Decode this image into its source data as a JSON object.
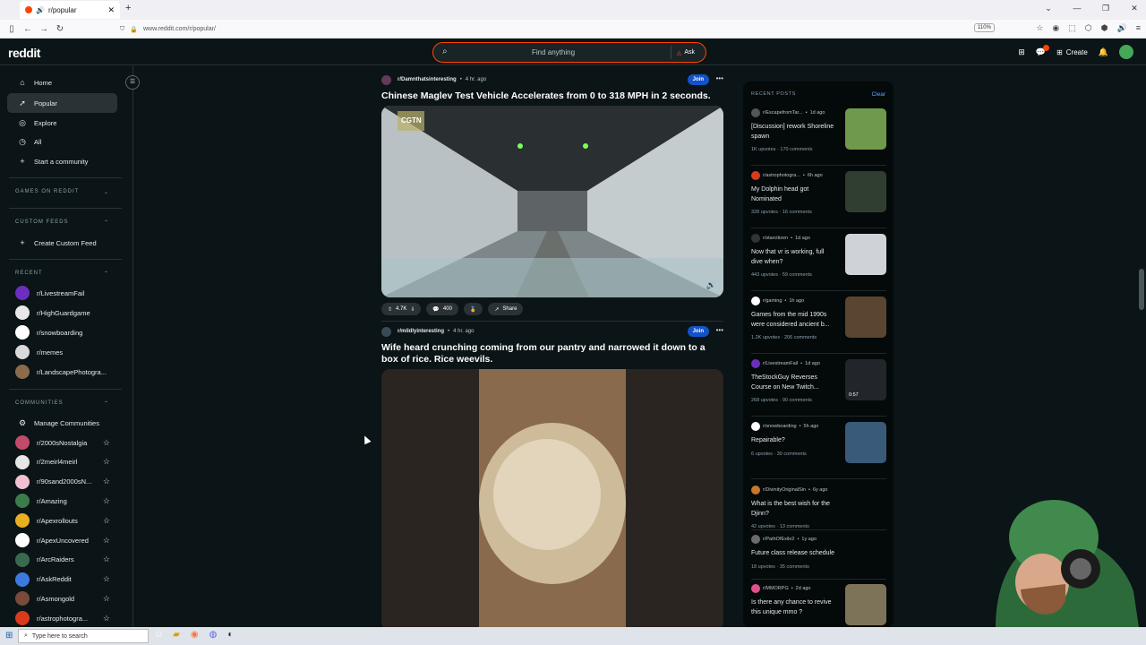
{
  "browser": {
    "tab_title": "r/popular",
    "url": "www.reddit.com/r/popular/",
    "zoom": "110%"
  },
  "header": {
    "logo": "reddit",
    "search_placeholder": "Find anything",
    "ask_label": "Ask",
    "create_label": "Create"
  },
  "sidebar": {
    "nav": [
      {
        "label": "Home",
        "icon": "home-icon"
      },
      {
        "label": "Popular",
        "icon": "popular-icon"
      },
      {
        "label": "Explore",
        "icon": "explore-icon"
      },
      {
        "label": "All",
        "icon": "all-icon"
      },
      {
        "label": "Start a community",
        "icon": "plus-icon"
      }
    ],
    "games_heading": "GAMES ON REDDIT",
    "custom_feeds_heading": "CUSTOM FEEDS",
    "create_custom_feed": "Create Custom Feed",
    "recent_heading": "RECENT",
    "recent": [
      {
        "label": "r/LivestreamFail",
        "color": "#6b2fbf"
      },
      {
        "label": "r/HighGuardgame",
        "color": "#e8e8e8"
      },
      {
        "label": "r/snowboarding",
        "color": "#ffffff"
      },
      {
        "label": "r/memes",
        "color": "#d9d9d9"
      },
      {
        "label": "r/LandscapePhotogra...",
        "color": "#8a6b4a"
      }
    ],
    "communities_heading": "COMMUNITIES",
    "manage_communities": "Manage Communities",
    "communities": [
      {
        "label": "r/2000sNostalgia",
        "color": "#c24a6a"
      },
      {
        "label": "r/2meirl4meirl",
        "color": "#e6e6e6"
      },
      {
        "label": "r/90sand2000sN...",
        "color": "#f2c1d1"
      },
      {
        "label": "r/Amazing",
        "color": "#3e7b4a"
      },
      {
        "label": "r/Apexrollouts",
        "color": "#e8b020"
      },
      {
        "label": "r/ApexUncovered",
        "color": "#ffffff"
      },
      {
        "label": "r/ArcRaiders",
        "color": "#3a6a4e"
      },
      {
        "label": "r/AskReddit",
        "color": "#3d7ae0"
      },
      {
        "label": "r/Asmongold",
        "color": "#7a4a3a"
      },
      {
        "label": "r/astrophotogra...",
        "color": "#d83a1c"
      }
    ]
  },
  "feed": {
    "posts": [
      {
        "subreddit": "r/Damnthatsinteresting",
        "time": "4 hr. ago",
        "join": "Join",
        "title": "Chinese Maglev Test Vehicle Accelerates from 0 to 318 MPH in 2 seconds.",
        "video_watermark": "CGTN",
        "upvotes": "4.7K",
        "comments": "400",
        "share": "Share"
      },
      {
        "subreddit": "r/mildlyinteresting",
        "time": "4 hr. ago",
        "join": "Join",
        "title": "Wife heard crunching coming from our pantry and narrowed it down to a box of rice. Rice weevils."
      }
    ]
  },
  "recent_posts": {
    "heading": "RECENT POSTS",
    "clear": "Clear",
    "items": [
      {
        "sub": "r/EscapefromTar...",
        "time": "1d ago",
        "title": "[Discussion] rework Shoreline spawn",
        "upvotes": "1K upvotes",
        "comments": "170 comments",
        "icon_color": "#555555",
        "thumb_color": "#6f9a4d"
      },
      {
        "sub": "r/astrophotogra...",
        "time": "6h ago",
        "title": "My Dolphin head got Nominated",
        "upvotes": "328 upvotes",
        "comments": "16 comments",
        "icon_color": "#d83a1c",
        "thumb_color": "#2f3e30"
      },
      {
        "sub": "r/starcitizen",
        "time": "1d ago",
        "title": "Now that vr is working, full dive when?",
        "upvotes": "443 upvotes",
        "comments": "59 comments",
        "icon_color": "#333333",
        "thumb_color": "#cfd3d8"
      },
      {
        "sub": "r/gaming",
        "time": "1h ago",
        "title": "Games from the mid 1990s were considered ancient b...",
        "upvotes": "1.2K upvotes",
        "comments": "206 comments",
        "icon_color": "#ffffff",
        "thumb_color": "#5a4630"
      },
      {
        "sub": "r/LivestreamFail",
        "time": "1d ago",
        "title": "TheStockGuy Reverses Course on New Twitch...",
        "upvotes": "268 upvotes",
        "comments": "90 comments",
        "icon_color": "#6b2fbf",
        "thumb_color": "#22262b",
        "duration": "0:57"
      },
      {
        "sub": "r/snowboarding",
        "time": "5h ago",
        "title": "Repairable?",
        "upvotes": "6 upvotes",
        "comments": "30 comments",
        "icon_color": "#ffffff",
        "thumb_color": "#3a5a7a"
      },
      {
        "sub": "r/DivinityOriginalSin",
        "time": "6y ago",
        "title": "What is the best wish for the Djinn?",
        "upvotes": "42 upvotes",
        "comments": "13 comments",
        "icon_color": "#c7782a"
      },
      {
        "sub": "r/PathOfExile2",
        "time": "1y ago",
        "title": "Future class release schedule",
        "upvotes": "18 upvotes",
        "comments": "35 comments",
        "icon_color": "#6b6b6b"
      },
      {
        "sub": "r/MMORPG",
        "time": "2d ago",
        "title": "Is there any chance to revive this unique mmo ?",
        "upvotes": "",
        "comments": "",
        "icon_color": "#e0508a",
        "thumb_color": "#7d7358"
      }
    ]
  },
  "taskbar": {
    "search_placeholder": "Type here to search"
  }
}
